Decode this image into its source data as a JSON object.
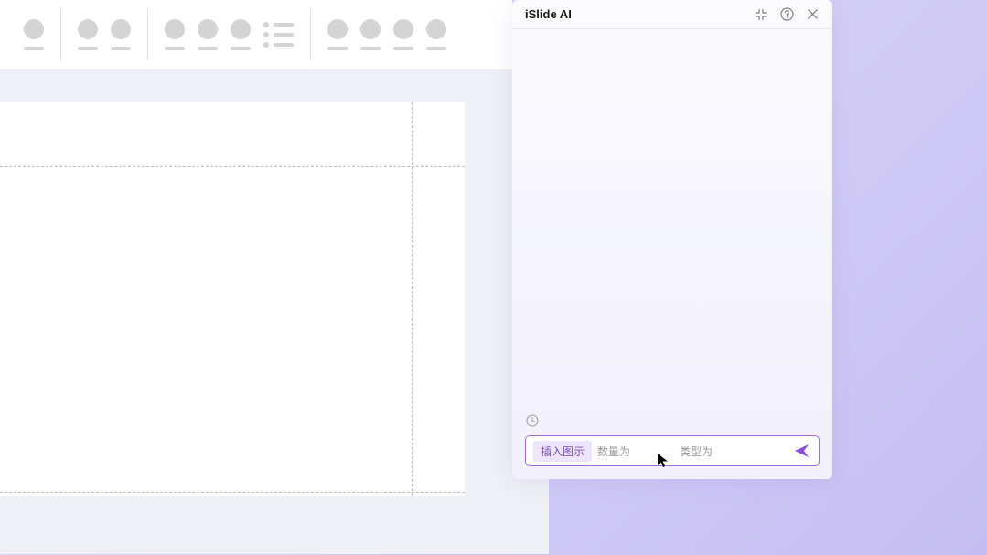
{
  "panel": {
    "title": "iSlide AI"
  },
  "input": {
    "action_chip": "插入图示",
    "quantity_label": "数量为",
    "quantity_value": "",
    "type_label": "类型为",
    "type_value": ""
  }
}
